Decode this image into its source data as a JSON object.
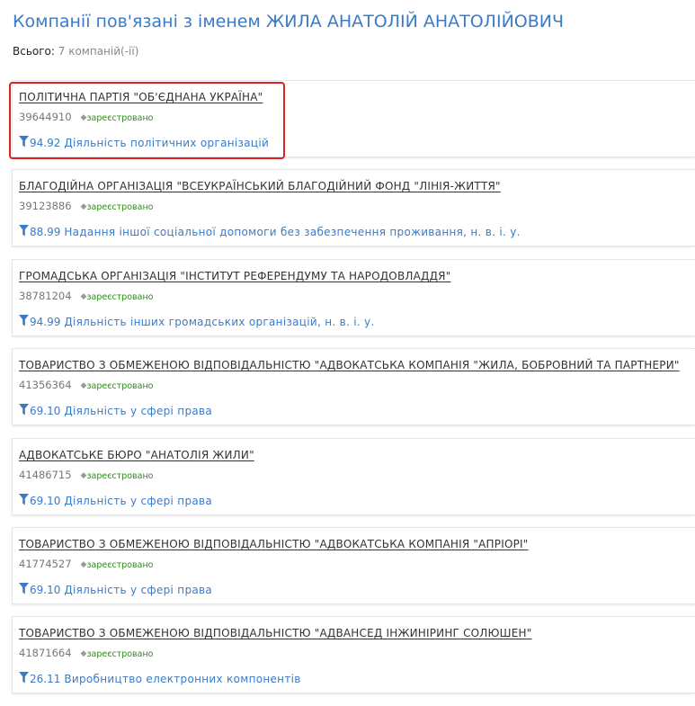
{
  "page": {
    "title": "Компанії пов'язані з іменем ЖИЛА АНАТОЛІЙ АНАТОЛІЙОВИЧ",
    "total_label": "Всього:",
    "total_value": "7 компаній(-ії)"
  },
  "colors": {
    "accent": "#3a7bc8",
    "status_green": "#2e8b1e",
    "highlight_red": "#e0201e"
  },
  "companies": [
    {
      "name": "ПОЛІТИЧНА ПАРТІЯ \"ОБ'ЄДНАНА УКРАЇНА\"",
      "code": "39644910",
      "status": "зареєстровано",
      "kved_code": "94.92",
      "kved_name": "Діяльність політичних організацій",
      "highlighted": true
    },
    {
      "name": "БЛАГОДІЙНА ОРГАНІЗАЦІЯ \"ВСЕУКРАЇНСЬКИЙ БЛАГОДІЙНИЙ ФОНД \"ЛІНІЯ-ЖИТТЯ\"",
      "code": "39123886",
      "status": "зареєстровано",
      "kved_code": "88.99",
      "kved_name": "Надання іншої соціальної допомоги без забезпечення проживання, н. в. і. у."
    },
    {
      "name": "ГРОМАДСЬКА ОРГАНІЗАЦІЯ \"ІНСТИТУТ РЕФЕРЕНДУМУ ТА НАРОДОВЛАДДЯ\"",
      "code": "38781204",
      "status": "зареєстровано",
      "kved_code": "94.99",
      "kved_name": "Діяльність інших громадських організацій, н. в. і. у."
    },
    {
      "name": "ТОВАРИСТВО З ОБМЕЖЕНОЮ ВІДПОВІДАЛЬНІСТЮ \"АДВОКАТСЬКА КОМПАНІЯ \"ЖИЛА, БОБРОВНИЙ ТА ПАРТНЕРИ\"",
      "code": "41356364",
      "status": "зареєстровано",
      "kved_code": "69.10",
      "kved_name": "Діяльність у сфері права"
    },
    {
      "name": "АДВОКАТСЬКЕ БЮРО \"АНАТОЛІЯ ЖИЛИ\"",
      "code": "41486715",
      "status": "зареєстровано",
      "kved_code": "69.10",
      "kved_name": "Діяльність у сфері права"
    },
    {
      "name": "ТОВАРИСТВО З ОБМЕЖЕНОЮ ВІДПОВІДАЛЬНІСТЮ \"АДВОКАТСЬКА КОМПАНІЯ \"АПРІОРІ\"",
      "code": "41774527",
      "status": "зареєстровано",
      "kved_code": "69.10",
      "kved_name": "Діяльність у сфері права"
    },
    {
      "name": "ТОВАРИСТВО З ОБМЕЖЕНОЮ ВІДПОВІДАЛЬНІСТЮ \"АДВАНСЕД ІНЖИНІРИНГ СОЛЮШЕН\"",
      "code": "41871664",
      "status": "зареєстровано",
      "kved_code": "26.11",
      "kved_name": "Виробництво електронних компонентів"
    }
  ]
}
